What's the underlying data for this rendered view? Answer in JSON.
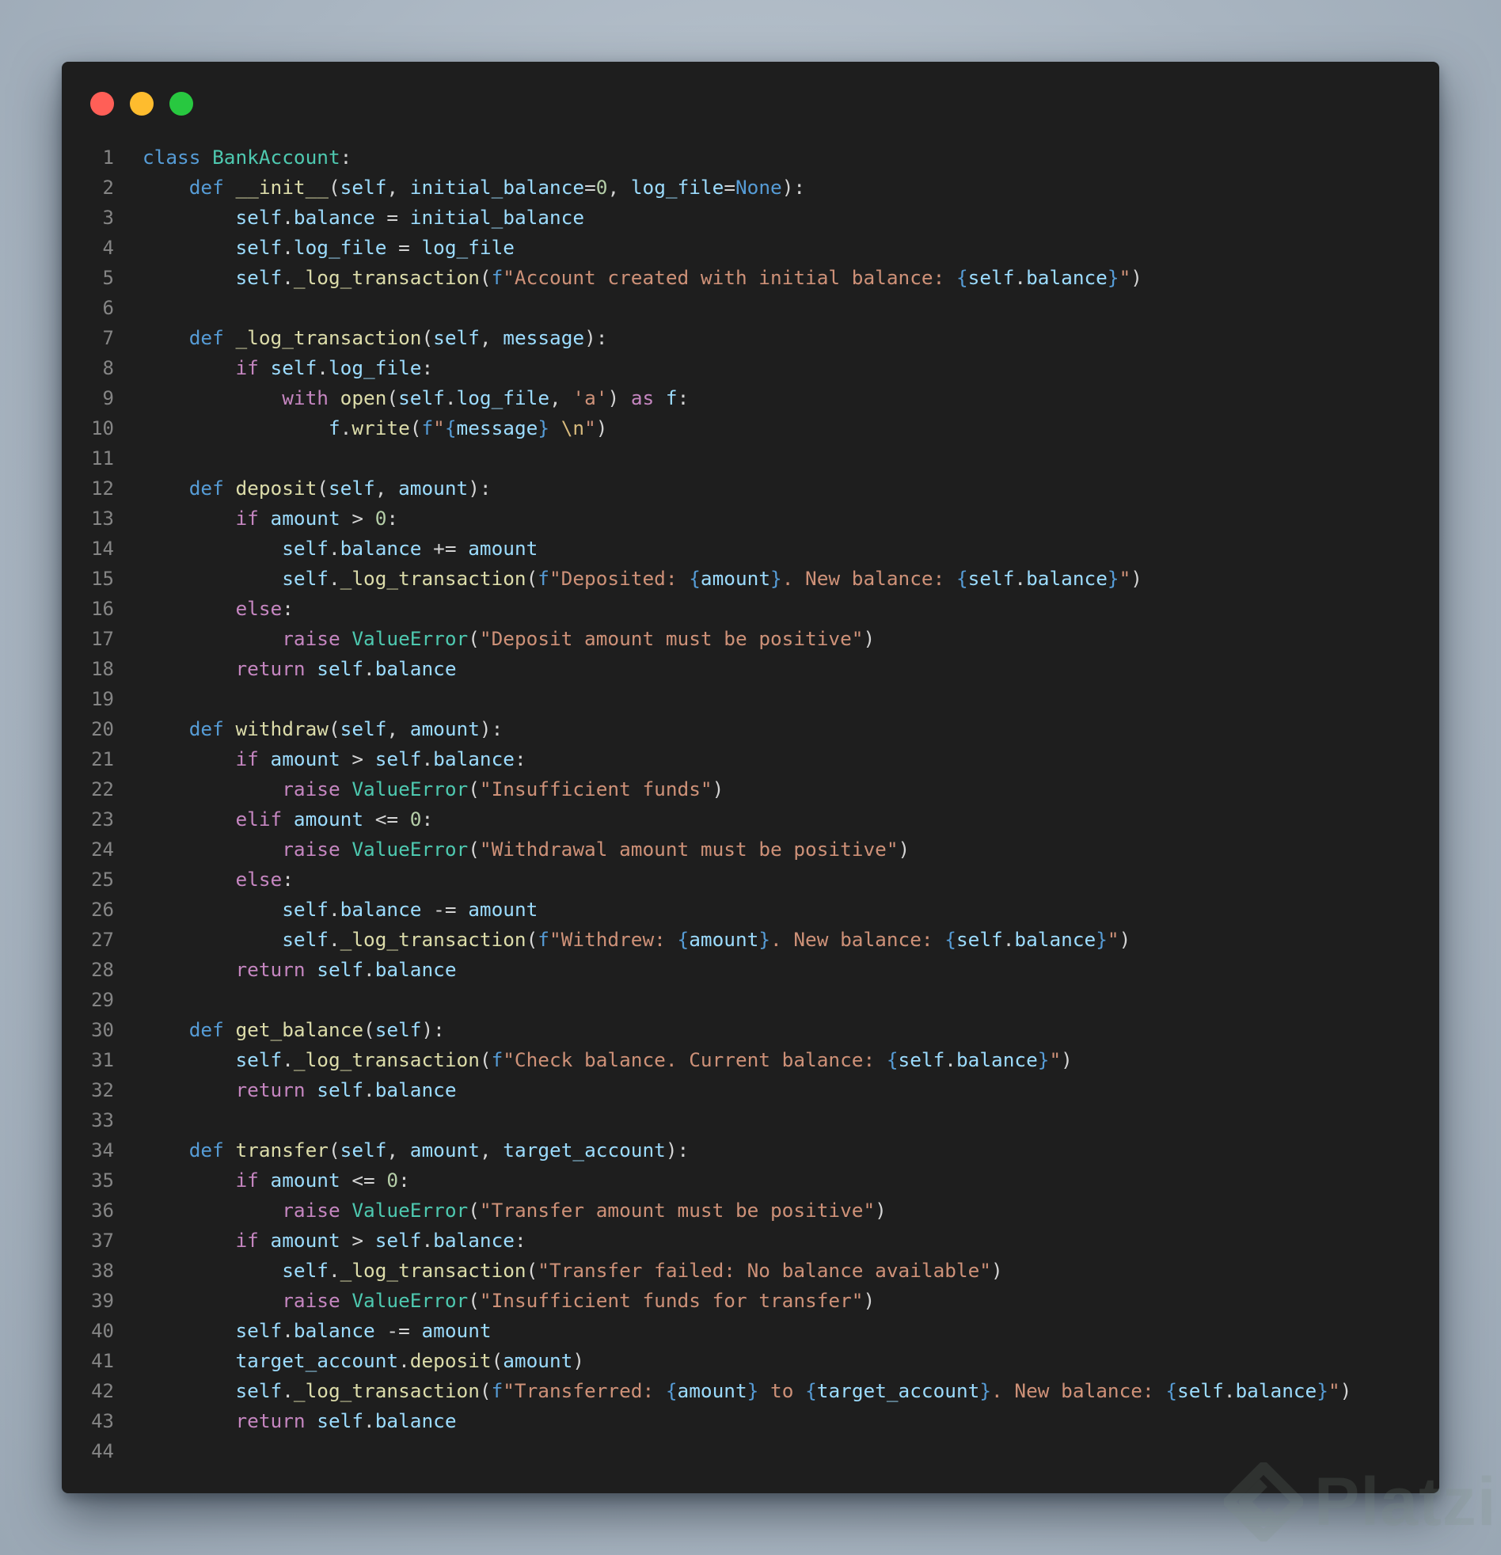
{
  "window": {
    "buttons": [
      {
        "name": "close",
        "color": "#ff5f57"
      },
      {
        "name": "minimize",
        "color": "#febc2e"
      },
      {
        "name": "maximize",
        "color": "#28c840"
      }
    ]
  },
  "colors": {
    "background": "#1e1e1e",
    "keyword": "#569cd6",
    "control": "#c586c0",
    "class_name": "#4ec9b0",
    "function": "#dcdcaa",
    "variable": "#9cdcfe",
    "string": "#ce9178",
    "number": "#b5cea8",
    "plain": "#d4d4d4",
    "line_number": "#858585"
  },
  "code_lines": [
    [
      [
        "kw",
        "class"
      ],
      [
        "pl",
        " "
      ],
      [
        "cls",
        "BankAccount"
      ],
      [
        "pl",
        ":"
      ]
    ],
    [
      [
        "pl",
        "    "
      ],
      [
        "kw",
        "def"
      ],
      [
        "pl",
        " "
      ],
      [
        "fn",
        "__init__"
      ],
      [
        "pl",
        "("
      ],
      [
        "var",
        "self"
      ],
      [
        "pl",
        ", "
      ],
      [
        "var",
        "initial_balance"
      ],
      [
        "pl",
        "="
      ],
      [
        "num",
        "0"
      ],
      [
        "pl",
        ", "
      ],
      [
        "var",
        "log_file"
      ],
      [
        "pl",
        "="
      ],
      [
        "kw",
        "None"
      ],
      [
        "pl",
        "):"
      ]
    ],
    [
      [
        "pl",
        "        "
      ],
      [
        "var",
        "self"
      ],
      [
        "pl",
        "."
      ],
      [
        "var",
        "balance"
      ],
      [
        "pl",
        " = "
      ],
      [
        "var",
        "initial_balance"
      ]
    ],
    [
      [
        "pl",
        "        "
      ],
      [
        "var",
        "self"
      ],
      [
        "pl",
        "."
      ],
      [
        "var",
        "log_file"
      ],
      [
        "pl",
        " = "
      ],
      [
        "var",
        "log_file"
      ]
    ],
    [
      [
        "pl",
        "        "
      ],
      [
        "var",
        "self"
      ],
      [
        "pl",
        "."
      ],
      [
        "fn",
        "_log_transaction"
      ],
      [
        "pl",
        "("
      ],
      [
        "kw",
        "f"
      ],
      [
        "str",
        "\"Account created with initial balance: "
      ],
      [
        "br",
        "{"
      ],
      [
        "var",
        "self"
      ],
      [
        "pl",
        "."
      ],
      [
        "var",
        "balance"
      ],
      [
        "br",
        "}"
      ],
      [
        "str",
        "\""
      ],
      [
        "pl",
        ")"
      ]
    ],
    [],
    [
      [
        "pl",
        "    "
      ],
      [
        "kw",
        "def"
      ],
      [
        "pl",
        " "
      ],
      [
        "fn",
        "_log_transaction"
      ],
      [
        "pl",
        "("
      ],
      [
        "var",
        "self"
      ],
      [
        "pl",
        ", "
      ],
      [
        "var",
        "message"
      ],
      [
        "pl",
        "):"
      ]
    ],
    [
      [
        "pl",
        "        "
      ],
      [
        "ctrl",
        "if"
      ],
      [
        "pl",
        " "
      ],
      [
        "var",
        "self"
      ],
      [
        "pl",
        "."
      ],
      [
        "var",
        "log_file"
      ],
      [
        "pl",
        ":"
      ]
    ],
    [
      [
        "pl",
        "            "
      ],
      [
        "ctrl",
        "with"
      ],
      [
        "pl",
        " "
      ],
      [
        "fn",
        "open"
      ],
      [
        "pl",
        "("
      ],
      [
        "var",
        "self"
      ],
      [
        "pl",
        "."
      ],
      [
        "var",
        "log_file"
      ],
      [
        "pl",
        ", "
      ],
      [
        "str",
        "'a'"
      ],
      [
        "pl",
        ") "
      ],
      [
        "ctrl",
        "as"
      ],
      [
        "pl",
        " "
      ],
      [
        "var",
        "f"
      ],
      [
        "pl",
        ":"
      ]
    ],
    [
      [
        "pl",
        "                "
      ],
      [
        "var",
        "f"
      ],
      [
        "pl",
        "."
      ],
      [
        "fn",
        "write"
      ],
      [
        "pl",
        "("
      ],
      [
        "kw",
        "f"
      ],
      [
        "str",
        "\""
      ],
      [
        "br",
        "{"
      ],
      [
        "var",
        "message"
      ],
      [
        "br",
        "}"
      ],
      [
        "str",
        " "
      ],
      [
        "esc",
        "\\n"
      ],
      [
        "str",
        "\""
      ],
      [
        "pl",
        ")"
      ]
    ],
    [],
    [
      [
        "pl",
        "    "
      ],
      [
        "kw",
        "def"
      ],
      [
        "pl",
        " "
      ],
      [
        "fn",
        "deposit"
      ],
      [
        "pl",
        "("
      ],
      [
        "var",
        "self"
      ],
      [
        "pl",
        ", "
      ],
      [
        "var",
        "amount"
      ],
      [
        "pl",
        "):"
      ]
    ],
    [
      [
        "pl",
        "        "
      ],
      [
        "ctrl",
        "if"
      ],
      [
        "pl",
        " "
      ],
      [
        "var",
        "amount"
      ],
      [
        "pl",
        " > "
      ],
      [
        "num",
        "0"
      ],
      [
        "pl",
        ":"
      ]
    ],
    [
      [
        "pl",
        "            "
      ],
      [
        "var",
        "self"
      ],
      [
        "pl",
        "."
      ],
      [
        "var",
        "balance"
      ],
      [
        "pl",
        " += "
      ],
      [
        "var",
        "amount"
      ]
    ],
    [
      [
        "pl",
        "            "
      ],
      [
        "var",
        "self"
      ],
      [
        "pl",
        "."
      ],
      [
        "fn",
        "_log_transaction"
      ],
      [
        "pl",
        "("
      ],
      [
        "kw",
        "f"
      ],
      [
        "str",
        "\"Deposited: "
      ],
      [
        "br",
        "{"
      ],
      [
        "var",
        "amount"
      ],
      [
        "br",
        "}"
      ],
      [
        "str",
        ". New balance: "
      ],
      [
        "br",
        "{"
      ],
      [
        "var",
        "self"
      ],
      [
        "pl",
        "."
      ],
      [
        "var",
        "balance"
      ],
      [
        "br",
        "}"
      ],
      [
        "str",
        "\""
      ],
      [
        "pl",
        ")"
      ]
    ],
    [
      [
        "pl",
        "        "
      ],
      [
        "ctrl",
        "else"
      ],
      [
        "pl",
        ":"
      ]
    ],
    [
      [
        "pl",
        "            "
      ],
      [
        "ctrl",
        "raise"
      ],
      [
        "pl",
        " "
      ],
      [
        "cls",
        "ValueError"
      ],
      [
        "pl",
        "("
      ],
      [
        "str",
        "\"Deposit amount must be positive\""
      ],
      [
        "pl",
        ")"
      ]
    ],
    [
      [
        "pl",
        "        "
      ],
      [
        "ctrl",
        "return"
      ],
      [
        "pl",
        " "
      ],
      [
        "var",
        "self"
      ],
      [
        "pl",
        "."
      ],
      [
        "var",
        "balance"
      ]
    ],
    [],
    [
      [
        "pl",
        "    "
      ],
      [
        "kw",
        "def"
      ],
      [
        "pl",
        " "
      ],
      [
        "fn",
        "withdraw"
      ],
      [
        "pl",
        "("
      ],
      [
        "var",
        "self"
      ],
      [
        "pl",
        ", "
      ],
      [
        "var",
        "amount"
      ],
      [
        "pl",
        "):"
      ]
    ],
    [
      [
        "pl",
        "        "
      ],
      [
        "ctrl",
        "if"
      ],
      [
        "pl",
        " "
      ],
      [
        "var",
        "amount"
      ],
      [
        "pl",
        " > "
      ],
      [
        "var",
        "self"
      ],
      [
        "pl",
        "."
      ],
      [
        "var",
        "balance"
      ],
      [
        "pl",
        ":"
      ]
    ],
    [
      [
        "pl",
        "            "
      ],
      [
        "ctrl",
        "raise"
      ],
      [
        "pl",
        " "
      ],
      [
        "cls",
        "ValueError"
      ],
      [
        "pl",
        "("
      ],
      [
        "str",
        "\"Insufficient funds\""
      ],
      [
        "pl",
        ")"
      ]
    ],
    [
      [
        "pl",
        "        "
      ],
      [
        "ctrl",
        "elif"
      ],
      [
        "pl",
        " "
      ],
      [
        "var",
        "amount"
      ],
      [
        "pl",
        " <= "
      ],
      [
        "num",
        "0"
      ],
      [
        "pl",
        ":"
      ]
    ],
    [
      [
        "pl",
        "            "
      ],
      [
        "ctrl",
        "raise"
      ],
      [
        "pl",
        " "
      ],
      [
        "cls",
        "ValueError"
      ],
      [
        "pl",
        "("
      ],
      [
        "str",
        "\"Withdrawal amount must be positive\""
      ],
      [
        "pl",
        ")"
      ]
    ],
    [
      [
        "pl",
        "        "
      ],
      [
        "ctrl",
        "else"
      ],
      [
        "pl",
        ":"
      ]
    ],
    [
      [
        "pl",
        "            "
      ],
      [
        "var",
        "self"
      ],
      [
        "pl",
        "."
      ],
      [
        "var",
        "balance"
      ],
      [
        "pl",
        " -= "
      ],
      [
        "var",
        "amount"
      ]
    ],
    [
      [
        "pl",
        "            "
      ],
      [
        "var",
        "self"
      ],
      [
        "pl",
        "."
      ],
      [
        "fn",
        "_log_transaction"
      ],
      [
        "pl",
        "("
      ],
      [
        "kw",
        "f"
      ],
      [
        "str",
        "\"Withdrew: "
      ],
      [
        "br",
        "{"
      ],
      [
        "var",
        "amount"
      ],
      [
        "br",
        "}"
      ],
      [
        "str",
        ". New balance: "
      ],
      [
        "br",
        "{"
      ],
      [
        "var",
        "self"
      ],
      [
        "pl",
        "."
      ],
      [
        "var",
        "balance"
      ],
      [
        "br",
        "}"
      ],
      [
        "str",
        "\""
      ],
      [
        "pl",
        ")"
      ]
    ],
    [
      [
        "pl",
        "        "
      ],
      [
        "ctrl",
        "return"
      ],
      [
        "pl",
        " "
      ],
      [
        "var",
        "self"
      ],
      [
        "pl",
        "."
      ],
      [
        "var",
        "balance"
      ]
    ],
    [],
    [
      [
        "pl",
        "    "
      ],
      [
        "kw",
        "def"
      ],
      [
        "pl",
        " "
      ],
      [
        "fn",
        "get_balance"
      ],
      [
        "pl",
        "("
      ],
      [
        "var",
        "self"
      ],
      [
        "pl",
        "):"
      ]
    ],
    [
      [
        "pl",
        "        "
      ],
      [
        "var",
        "self"
      ],
      [
        "pl",
        "."
      ],
      [
        "fn",
        "_log_transaction"
      ],
      [
        "pl",
        "("
      ],
      [
        "kw",
        "f"
      ],
      [
        "str",
        "\"Check balance. Current balance: "
      ],
      [
        "br",
        "{"
      ],
      [
        "var",
        "self"
      ],
      [
        "pl",
        "."
      ],
      [
        "var",
        "balance"
      ],
      [
        "br",
        "}"
      ],
      [
        "str",
        "\""
      ],
      [
        "pl",
        ")"
      ]
    ],
    [
      [
        "pl",
        "        "
      ],
      [
        "ctrl",
        "return"
      ],
      [
        "pl",
        " "
      ],
      [
        "var",
        "self"
      ],
      [
        "pl",
        "."
      ],
      [
        "var",
        "balance"
      ]
    ],
    [],
    [
      [
        "pl",
        "    "
      ],
      [
        "kw",
        "def"
      ],
      [
        "pl",
        " "
      ],
      [
        "fn",
        "transfer"
      ],
      [
        "pl",
        "("
      ],
      [
        "var",
        "self"
      ],
      [
        "pl",
        ", "
      ],
      [
        "var",
        "amount"
      ],
      [
        "pl",
        ", "
      ],
      [
        "var",
        "target_account"
      ],
      [
        "pl",
        "):"
      ]
    ],
    [
      [
        "pl",
        "        "
      ],
      [
        "ctrl",
        "if"
      ],
      [
        "pl",
        " "
      ],
      [
        "var",
        "amount"
      ],
      [
        "pl",
        " <= "
      ],
      [
        "num",
        "0"
      ],
      [
        "pl",
        ":"
      ]
    ],
    [
      [
        "pl",
        "            "
      ],
      [
        "ctrl",
        "raise"
      ],
      [
        "pl",
        " "
      ],
      [
        "cls",
        "ValueError"
      ],
      [
        "pl",
        "("
      ],
      [
        "str",
        "\"Transfer amount must be positive\""
      ],
      [
        "pl",
        ")"
      ]
    ],
    [
      [
        "pl",
        "        "
      ],
      [
        "ctrl",
        "if"
      ],
      [
        "pl",
        " "
      ],
      [
        "var",
        "amount"
      ],
      [
        "pl",
        " > "
      ],
      [
        "var",
        "self"
      ],
      [
        "pl",
        "."
      ],
      [
        "var",
        "balance"
      ],
      [
        "pl",
        ":"
      ]
    ],
    [
      [
        "pl",
        "            "
      ],
      [
        "var",
        "self"
      ],
      [
        "pl",
        "."
      ],
      [
        "fn",
        "_log_transaction"
      ],
      [
        "pl",
        "("
      ],
      [
        "str",
        "\"Transfer failed: No balance available\""
      ],
      [
        "pl",
        ")"
      ]
    ],
    [
      [
        "pl",
        "            "
      ],
      [
        "ctrl",
        "raise"
      ],
      [
        "pl",
        " "
      ],
      [
        "cls",
        "ValueError"
      ],
      [
        "pl",
        "("
      ],
      [
        "str",
        "\"Insufficient funds for transfer\""
      ],
      [
        "pl",
        ")"
      ]
    ],
    [
      [
        "pl",
        "        "
      ],
      [
        "var",
        "self"
      ],
      [
        "pl",
        "."
      ],
      [
        "var",
        "balance"
      ],
      [
        "pl",
        " -= "
      ],
      [
        "var",
        "amount"
      ]
    ],
    [
      [
        "pl",
        "        "
      ],
      [
        "var",
        "target_account"
      ],
      [
        "pl",
        "."
      ],
      [
        "fn",
        "deposit"
      ],
      [
        "pl",
        "("
      ],
      [
        "var",
        "amount"
      ],
      [
        "pl",
        ")"
      ]
    ],
    [
      [
        "pl",
        "        "
      ],
      [
        "var",
        "self"
      ],
      [
        "pl",
        "."
      ],
      [
        "fn",
        "_log_transaction"
      ],
      [
        "pl",
        "("
      ],
      [
        "kw",
        "f"
      ],
      [
        "str",
        "\"Transferred: "
      ],
      [
        "br",
        "{"
      ],
      [
        "var",
        "amount"
      ],
      [
        "br",
        "}"
      ],
      [
        "str",
        " to "
      ],
      [
        "br",
        "{"
      ],
      [
        "var",
        "target_account"
      ],
      [
        "br",
        "}"
      ],
      [
        "str",
        ". New balance: "
      ],
      [
        "br",
        "{"
      ],
      [
        "var",
        "self"
      ],
      [
        "pl",
        "."
      ],
      [
        "var",
        "balance"
      ],
      [
        "br",
        "}"
      ],
      [
        "str",
        "\""
      ],
      [
        "pl",
        ")"
      ]
    ],
    [
      [
        "pl",
        "        "
      ],
      [
        "ctrl",
        "return"
      ],
      [
        "pl",
        " "
      ],
      [
        "var",
        "self"
      ],
      [
        "pl",
        "."
      ],
      [
        "var",
        "balance"
      ]
    ],
    []
  ],
  "watermark": {
    "text": "Platzi",
    "icon": "platzi-logo-icon"
  }
}
